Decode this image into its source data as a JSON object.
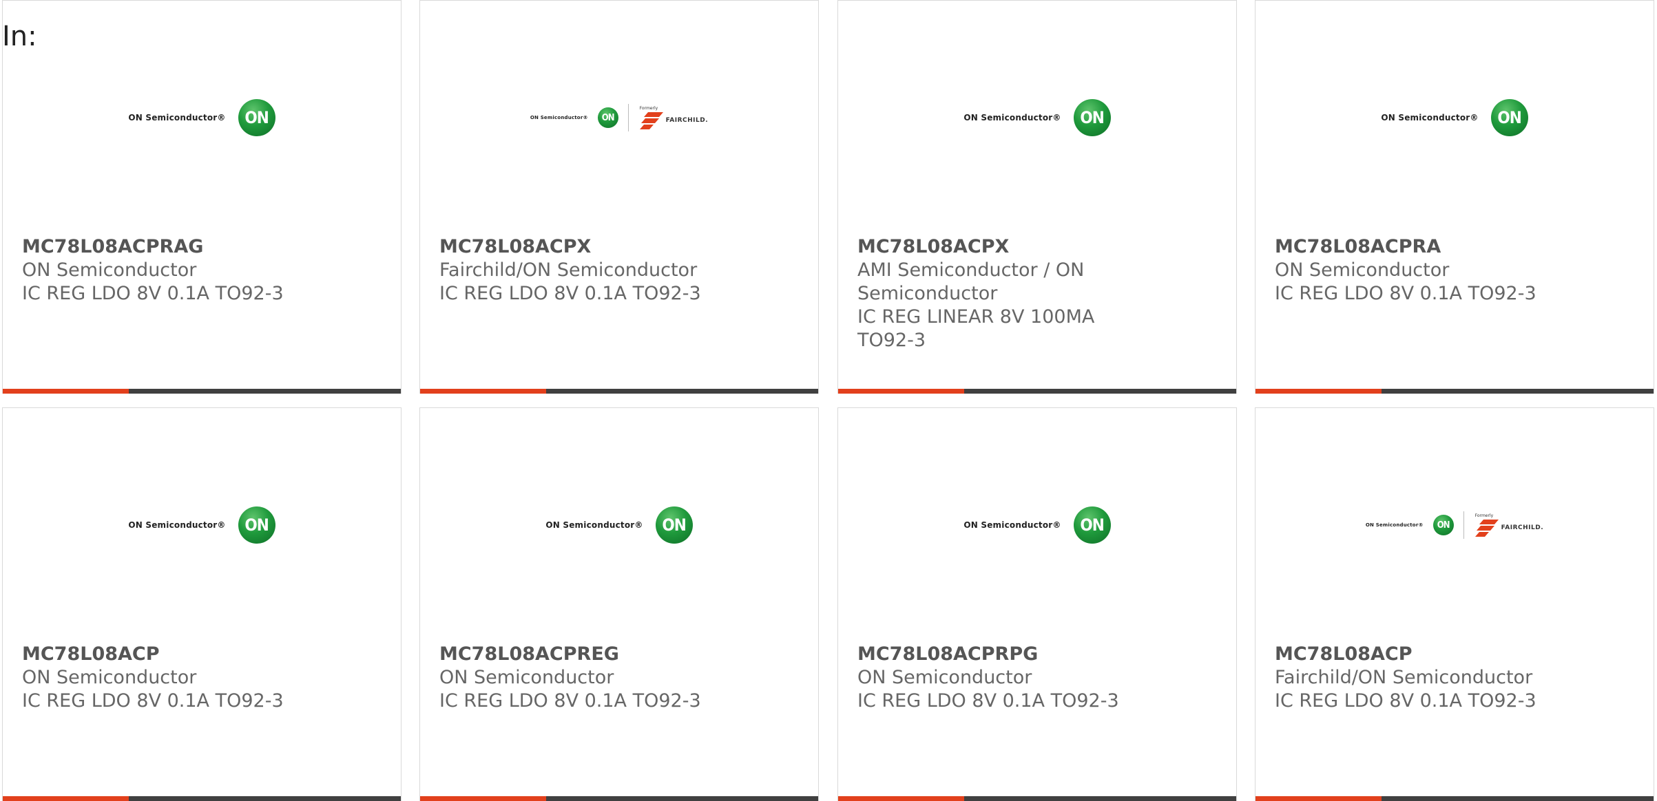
{
  "header": {
    "in_label": "In:"
  },
  "brand_colors": {
    "accent_bar": "#e2401c",
    "bar": "#404040",
    "on_green": "#1f9a3c",
    "fairchild_red": "#e2401c"
  },
  "products": [
    {
      "part_number": "MC78L08ACPRAG",
      "manufacturer": "ON Semiconductor",
      "description": "IC REG LDO 8V 0.1A TO92-3",
      "logo": "on-semiconductor-logo",
      "logo_text": "ON Semiconductor®",
      "logo_mark": "ON"
    },
    {
      "part_number": "MC78L08ACPX",
      "manufacturer": "Fairchild/ON Semiconductor",
      "description": "IC REG LDO 8V 0.1A TO92-3",
      "logo": "on-fairchild-logo",
      "logo_text": "ON Semiconductor®",
      "logo_mark": "ON",
      "formerly": "Formerly",
      "fairchild": "FAIRCHILD."
    },
    {
      "part_number": "MC78L08ACPX",
      "manufacturer": "AMI Semiconductor / ON Semiconductor",
      "description": "IC REG LINEAR 8V 100MA TO92-3",
      "logo": "on-semiconductor-logo",
      "logo_text": "ON Semiconductor®",
      "logo_mark": "ON"
    },
    {
      "part_number": "MC78L08ACPRA",
      "manufacturer": "ON Semiconductor",
      "description": "IC REG LDO 8V 0.1A TO92-3",
      "logo": "on-semiconductor-logo",
      "logo_text": "ON Semiconductor®",
      "logo_mark": "ON"
    },
    {
      "part_number": "MC78L08ACP",
      "manufacturer": "ON Semiconductor",
      "description": "IC REG LDO 8V 0.1A TO92-3",
      "logo": "on-semiconductor-logo",
      "logo_text": "ON Semiconductor®",
      "logo_mark": "ON"
    },
    {
      "part_number": "MC78L08ACPREG",
      "manufacturer": "ON Semiconductor",
      "description": "IC REG LDO 8V 0.1A TO92-3",
      "logo": "on-semiconductor-logo",
      "logo_text": "ON Semiconductor®",
      "logo_mark": "ON"
    },
    {
      "part_number": "MC78L08ACPRPG",
      "manufacturer": "ON Semiconductor",
      "description": "IC REG LDO 8V 0.1A TO92-3",
      "logo": "on-semiconductor-logo",
      "logo_text": "ON Semiconductor®",
      "logo_mark": "ON"
    },
    {
      "part_number": "MC78L08ACP",
      "manufacturer": "Fairchild/ON Semiconductor",
      "description": "IC REG LDO 8V 0.1A TO92-3",
      "logo": "on-fairchild-logo",
      "logo_text": "ON Semiconductor®",
      "logo_mark": "ON",
      "formerly": "Formerly",
      "fairchild": "FAIRCHILD."
    }
  ]
}
